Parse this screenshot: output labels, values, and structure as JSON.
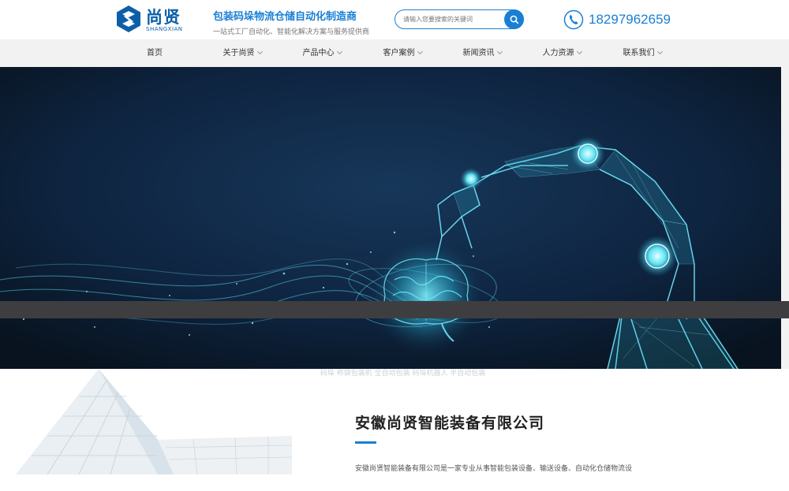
{
  "header": {
    "logo_cn": "尚贤",
    "logo_en": "SHANGXIAN",
    "slogan_main": "包装码垛物流仓储自动化制造商",
    "slogan_sub": "一站式工厂自动化、智能化解决方案与服务提供商",
    "search_placeholder": "请输入您要搜索的关键词",
    "phone": "18297962659"
  },
  "nav": {
    "items": [
      {
        "label": "首页"
      },
      {
        "label": "关于尚贤"
      },
      {
        "label": "产品中心"
      },
      {
        "label": "客户案例"
      },
      {
        "label": "新闻资讯"
      },
      {
        "label": "人力资源"
      },
      {
        "label": "联系我们"
      }
    ]
  },
  "band": {
    "hot_search": "热门搜索：   码垛   称袋包装机   全自动包装   码垛机器人   半自动包装"
  },
  "about": {
    "title": "安徽尚贤智能装备有限公司",
    "desc": "安徽尚贤智能装备有限公司是一家专业从事智能包装设备、输送设备、自动化仓储物流设"
  },
  "colors": {
    "accent": "#1a7fd4",
    "nav_bg": "#f2f2f2",
    "banner_bg": "#0c1b2e"
  }
}
